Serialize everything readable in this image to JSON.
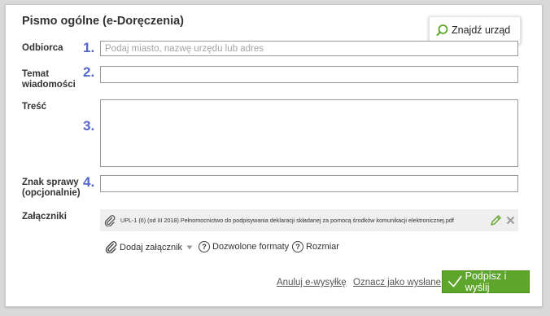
{
  "title": "Pismo ogólne (e-Doręczenia)",
  "find_office": {
    "label": "Znajdź urząd",
    "icon": "search-icon"
  },
  "fields": {
    "recipient": {
      "label": "Odbiorca",
      "number": "1.",
      "value": "",
      "placeholder": "Podaj miasto, nazwę urzędu lub adres"
    },
    "subject": {
      "label_line1": "Temat",
      "label_line2": "wiadomości",
      "number": "2.",
      "value": ""
    },
    "content": {
      "label": "Treść",
      "number": "3.",
      "value": ""
    },
    "case_ref": {
      "label_line1": "Znak sprawy",
      "label_line2": "(opcjonalnie)",
      "number": "4.",
      "value": ""
    }
  },
  "attachments": {
    "label": "Załączniki",
    "files": [
      {
        "name": "UPL-1 (6) (od III 2018) Pełnomocnictwo do podpisywania deklaracji składanej za pomocą środków komunikacji elektronicznej.pdf"
      }
    ],
    "add_label": "Dodaj załącznik",
    "allowed_formats_label": "Dozwolone formaty",
    "size_label": "Rozmiar"
  },
  "actions": {
    "cancel_label": "Anuluj e-wysyłkę",
    "mark_sent_label": "Oznacz jako wysłane",
    "submit_label": "Podpisz i wyślij"
  },
  "colors": {
    "accent_green": "#5ea52b",
    "number_blue": "#5566c9"
  }
}
